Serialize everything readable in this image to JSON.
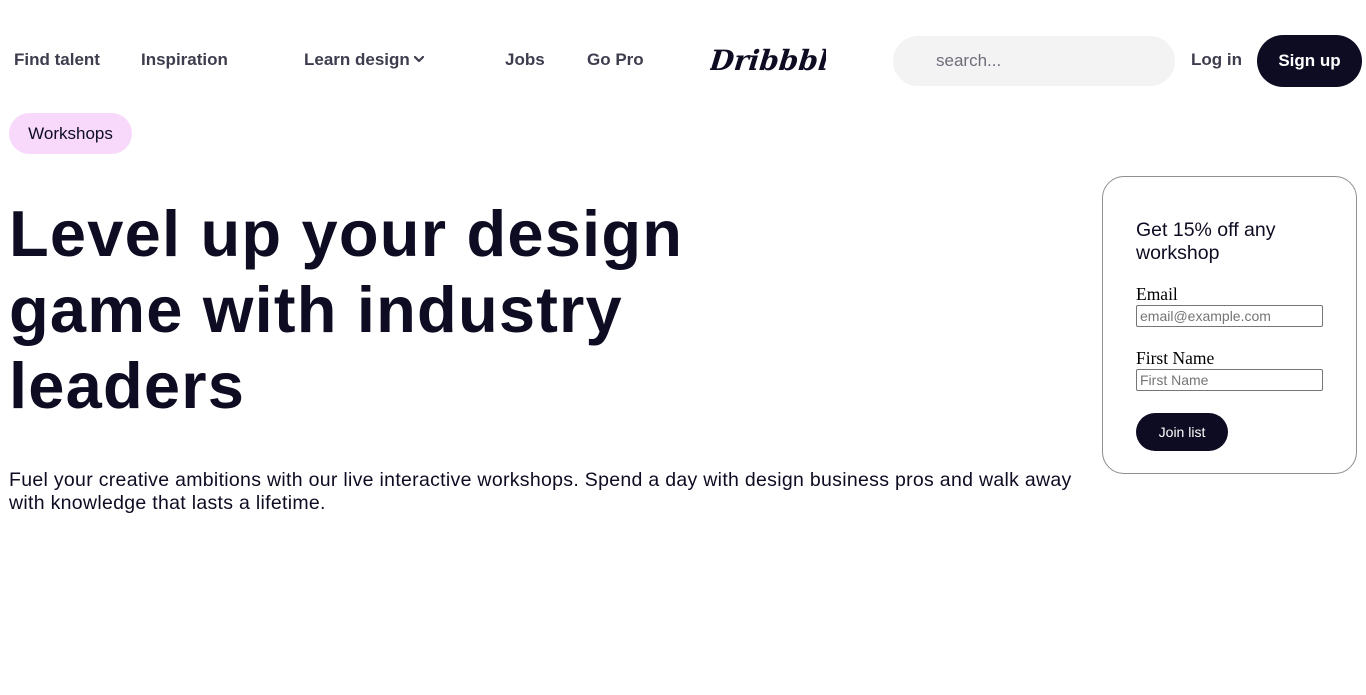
{
  "header": {
    "nav": {
      "find_talent": "Find talent",
      "inspiration": "Inspiration",
      "learn_design": "Learn design",
      "jobs": "Jobs",
      "go_pro": "Go Pro"
    },
    "logo_text": "Dribbble",
    "search_placeholder": "search...",
    "login": "Log in",
    "signup": "Sign up"
  },
  "badge": "Workshops",
  "headline": "Level up your design game with industry leaders",
  "subtext": "Fuel your creative ambitions with our live interactive workshops. Spend a day with design business pros and walk away with knowledge that lasts a lifetime.",
  "signup_card": {
    "title": "Get 15% off any workshop",
    "email_label": "Email",
    "email_placeholder": "email@example.com",
    "first_name_label": "First Name",
    "first_name_placeholder": "First Name",
    "submit": "Join list"
  },
  "colors": {
    "brand_dark": "#0d0c22",
    "badge_bg": "#f8d9fb",
    "search_bg": "#f3f3f4"
  }
}
